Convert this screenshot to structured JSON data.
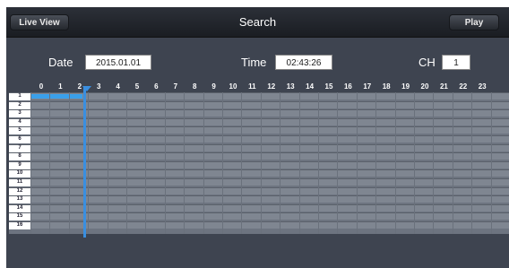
{
  "toolbar": {
    "live_view_label": "Live View",
    "title": "Search",
    "play_label": "Play"
  },
  "filters": {
    "date_label": "Date",
    "date_value": "2015.01.01",
    "time_label": "Time",
    "time_value": "02:43:26",
    "ch_label": "CH",
    "ch_value": "1"
  },
  "timeline": {
    "hours": [
      "0",
      "1",
      "2",
      "3",
      "4",
      "5",
      "6",
      "7",
      "8",
      "9",
      "10",
      "11",
      "12",
      "13",
      "14",
      "15",
      "16",
      "17",
      "18",
      "19",
      "20",
      "21",
      "22",
      "23"
    ],
    "channels": [
      "1",
      "2",
      "3",
      "4",
      "5",
      "6",
      "7",
      "8",
      "9",
      "10",
      "11",
      "12",
      "13",
      "14",
      "15",
      "16"
    ],
    "recording": [
      {
        "channel": "1",
        "start_hour": 0,
        "end_hour": 2.7
      }
    ],
    "cursor_hour": 2.7,
    "colors": {
      "recording": "#3aa0ea",
      "cursor": "#3a8fe0",
      "background": "#3e4450"
    }
  }
}
